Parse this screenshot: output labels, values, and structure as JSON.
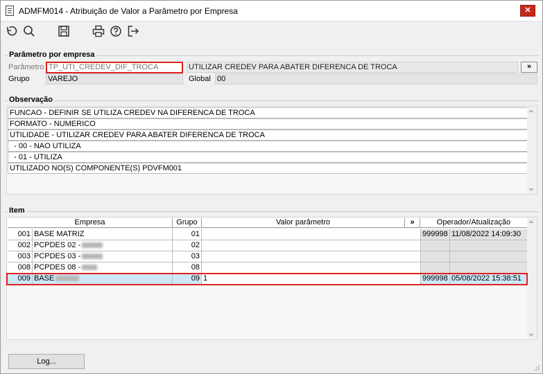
{
  "window": {
    "title": "ADMFM014 - Atribuição de Valor a Parâmetro por Empresa",
    "close_label": "✕"
  },
  "toolbar": {
    "icons": [
      "undo-icon",
      "search-icon",
      "save-icon",
      "print-icon",
      "help-icon",
      "exit-icon"
    ]
  },
  "parametro_section": {
    "legend": "Parâmetro por empresa",
    "parametro_label": "Parâmetro",
    "parametro_value": "TP_UTI_CREDEV_DIF_TROCA",
    "descricao_value": "UTILIZAR CREDEV PARA ABATER DIFERENCA DE TROCA",
    "expand_label": "»",
    "grupo_label": "Grupo",
    "grupo_value": "VAREJO",
    "global_label": "Global",
    "global_value": "00"
  },
  "observacao_section": {
    "legend": "Observação",
    "lines": [
      "FUNCAO - DEFINIR SE UTILIZA CREDEV NA DIFERENCA DE TROCA",
      "FORMATO - NUMERICO",
      "UTILIDADE - UTILIZAR CREDEV PARA ABATER DIFERENCA DE TROCA",
      "  - 00 - NAO UTILIZA",
      "  - 01 - UTILIZA",
      "UTILIZADO NO(S) COMPONENTE(S) PDVFM001"
    ]
  },
  "item_section": {
    "legend": "Item",
    "columns": {
      "empresa": "Empresa",
      "grupo": "Grupo",
      "valor": "Valor parâmetro",
      "expand": "»",
      "operador": "Operador/Atualização"
    },
    "rows": [
      {
        "code": "001",
        "name": "BASE MATRIZ",
        "grupo": "01",
        "valor": "",
        "operador": "999998",
        "data": "11/08/2022 14:09:30"
      },
      {
        "code": "002",
        "name": "PCPDES 02 -",
        "grupo": "02",
        "valor": "",
        "operador": "",
        "data": ""
      },
      {
        "code": "003",
        "name": "PCPDES 03 -",
        "grupo": "03",
        "valor": "",
        "operador": "",
        "data": ""
      },
      {
        "code": "008",
        "name": "PCPDES 08 -",
        "grupo": "08",
        "valor": "",
        "operador": "",
        "data": ""
      },
      {
        "code": "009",
        "name": "BASE",
        "grupo": "09",
        "valor": "1",
        "operador": "999998",
        "data": "05/08/2022 15:38:51"
      }
    ]
  },
  "footer": {
    "log_label": "Log..."
  }
}
